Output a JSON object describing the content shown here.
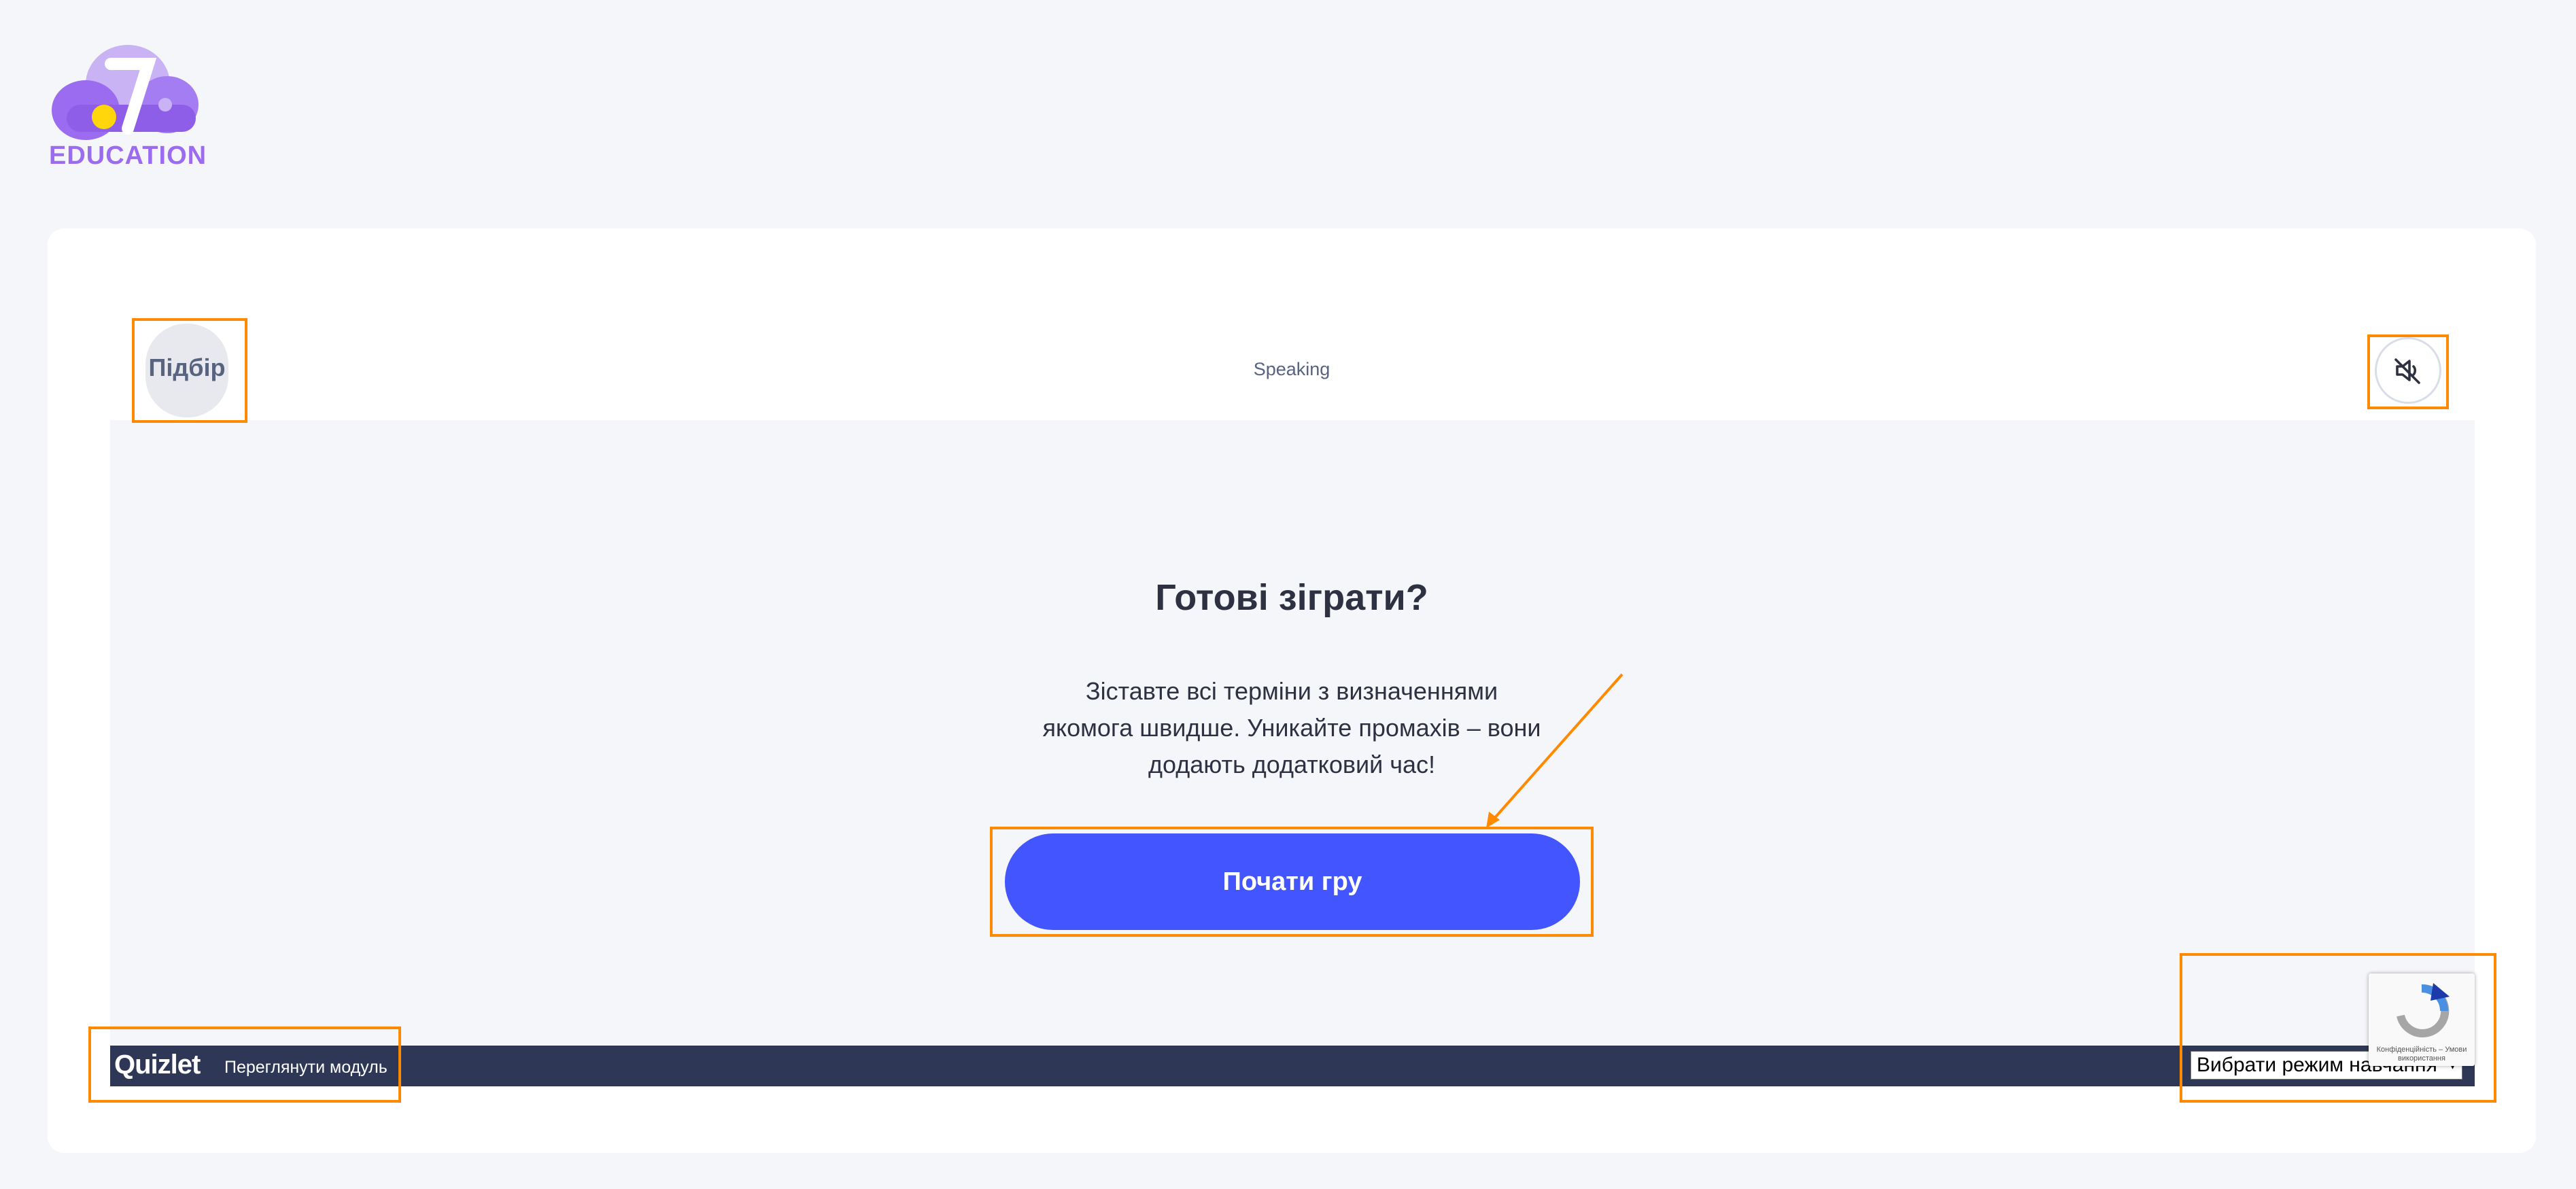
{
  "logo": {
    "text": "EDUCATION"
  },
  "game": {
    "mode_label": "Підбір",
    "set_title": "Speaking",
    "title": "Готові зіграти?",
    "description_lines": [
      "Зіставте всі терміни з визначеннями",
      "якомога швидше. Уникайте промахів – вони",
      "додають додатковий час!"
    ],
    "start_button": "Почати гру",
    "sound_icon": "sound-off-icon"
  },
  "footer": {
    "brand": "Quizlet",
    "view_module": "Переглянути модуль",
    "mode_select": "Вибрати режим навчання"
  },
  "recaptcha": {
    "text": "Конфіденційність – Умови використання"
  },
  "colors": {
    "accent": "#4255ff",
    "footer_bg": "#2e3856",
    "highlight": "#ff8a00",
    "logo": "#9b6cf0"
  }
}
